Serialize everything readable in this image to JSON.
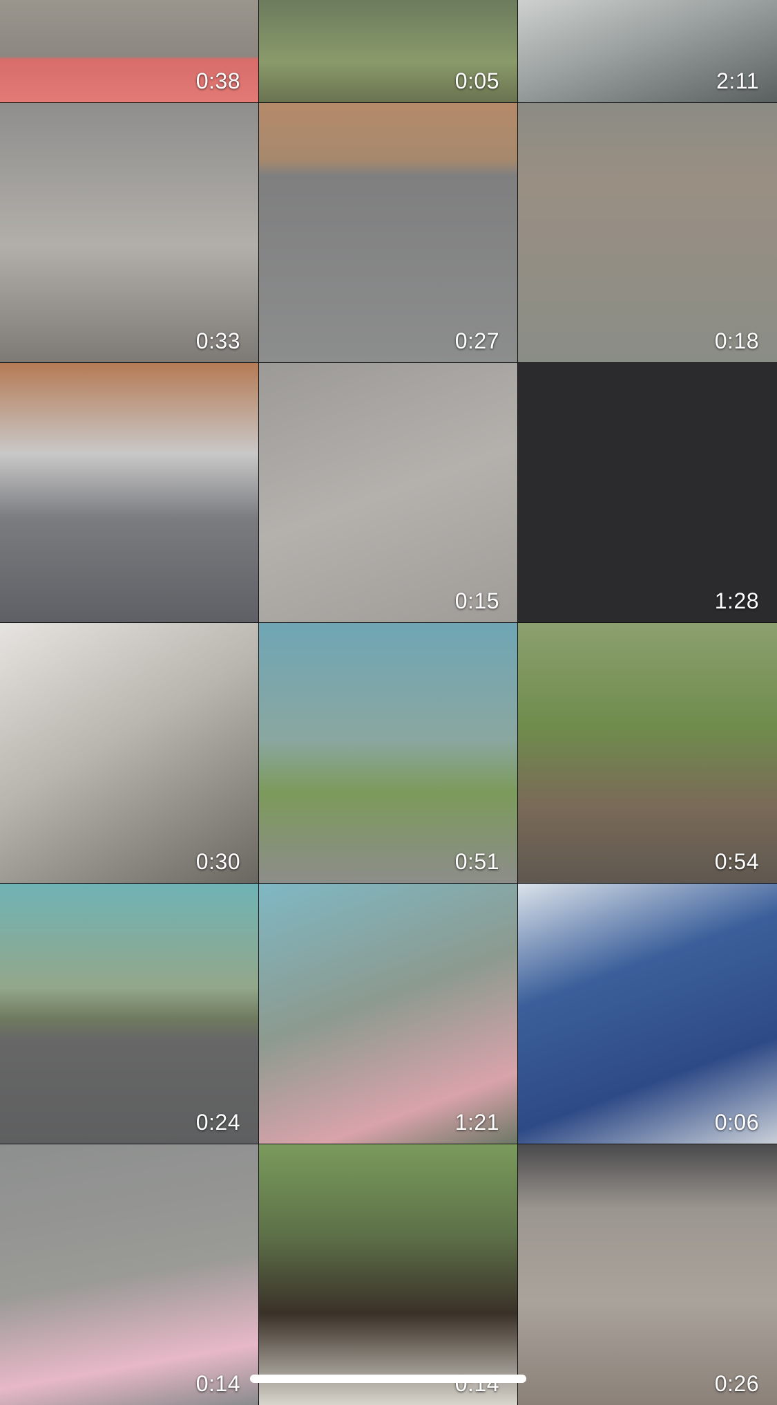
{
  "grid": {
    "videos": [
      {
        "duration": "0:38"
      },
      {
        "duration": "0:05"
      },
      {
        "duration": "2:11"
      },
      {
        "duration": "0:33"
      },
      {
        "duration": "0:27"
      },
      {
        "duration": "0:18"
      },
      {
        "duration": ""
      },
      {
        "duration": "0:15"
      },
      {
        "duration": "1:28"
      },
      {
        "duration": "0:30"
      },
      {
        "duration": "0:51"
      },
      {
        "duration": "0:54"
      },
      {
        "duration": "0:24"
      },
      {
        "duration": "1:21"
      },
      {
        "duration": "0:06"
      },
      {
        "duration": "0:14"
      },
      {
        "duration": "0:14"
      },
      {
        "duration": "0:26"
      }
    ]
  }
}
